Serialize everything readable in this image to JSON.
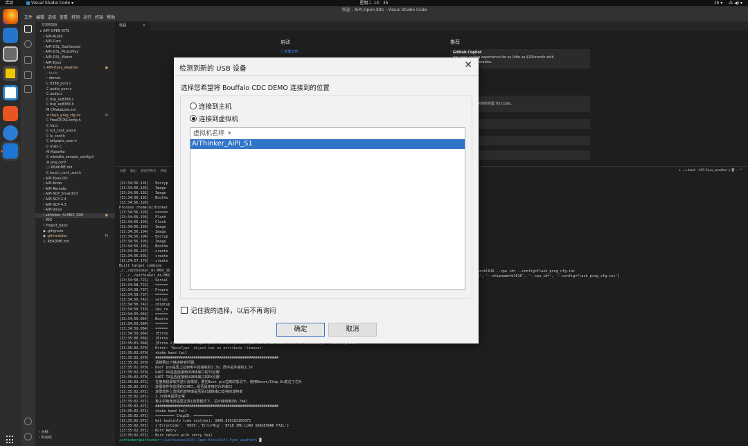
{
  "system_bar": {
    "activities": "活动",
    "app_name": "Visual Studio Code ▾",
    "clock": "星期二 13：35",
    "tray": [
      "zh ▾",
      "⁂ ◀) ▾"
    ]
  },
  "window": {
    "title": "欢迎 - AiPi-Open-Kits - Visual Studio Code",
    "menu": [
      "文件",
      "编辑",
      "选择",
      "查看",
      "转到",
      "运行",
      "终端",
      "帮助"
    ]
  },
  "explorer": {
    "header": "资源管理器",
    "items": [
      {
        "label": "∨ AIPI-OPEN-KITS",
        "indent": 0
      },
      {
        "label": "› AiPi-Audio",
        "indent": 1
      },
      {
        "label": "› AiPi-Cam",
        "indent": 1
      },
      {
        "label": "› AiPi-DSL_Dashboard",
        "indent": 1
      },
      {
        "label": "› AiPi-DSL_MusicPlay",
        "indent": 1
      },
      {
        "label": "› AiPi-DSL_Watch",
        "indent": 1
      },
      {
        "label": "› AiPi-Eyes",
        "indent": 1
      },
      {
        "label": "∨ AiPi-Eyes_weather",
        "indent": 1,
        "badge": "●",
        "color": "#e2c08d"
      },
      {
        "label": "› build",
        "indent": 2,
        "color": "#8c8c8c"
      },
      {
        "label": "› demos",
        "indent": 2
      },
      {
        "label": "C  8388_pcm.c",
        "indent": 2
      },
      {
        "label": "C  audio_pcm.c",
        "indent": 2
      },
      {
        "label": "C  audio.c",
        "indent": 2
      },
      {
        "label": "C  bsp_es8388.c",
        "indent": 2
      },
      {
        "label": "C  bsp_es8388.h",
        "indent": 2
      },
      {
        "label": "M  CMakeLists.txt",
        "indent": 2
      },
      {
        "label": "≡  flash_prog_cfg.ini",
        "indent": 2,
        "badge": "M",
        "color": "#e2c08d"
      },
      {
        "label": "C  FreeRTOSConfig.h",
        "indent": 2
      },
      {
        "label": "C  hal.c",
        "indent": 2
      },
      {
        "label": "C  lcd_conf_user.h",
        "indent": 2
      },
      {
        "label": "C  lv_conf.h",
        "indent": 2
      },
      {
        "label": "C  lwipopts_user.h",
        "indent": 2
      },
      {
        "label": "C  main.c",
        "indent": 2
      },
      {
        "label": "M  Makefile",
        "indent": 2
      },
      {
        "label": "C  mbedtls_sample_config.h",
        "indent": 2
      },
      {
        "label": "⚙  proj.conf",
        "indent": 2
      },
      {
        "label": "ⓘ  README.md",
        "indent": 2
      },
      {
        "label": "C  touch_conf_user.h",
        "indent": 2
      },
      {
        "label": "› AiPi-Eyes-DU",
        "indent": 1
      },
      {
        "label": "› AiPi-Knob",
        "indent": 1
      },
      {
        "label": "› AiPi-Remote",
        "indent": 1
      },
      {
        "label": "› AiPi-SCP_SmartCtrl",
        "indent": 1
      },
      {
        "label": "› AiPi-SCP-2.4",
        "indent": 1
      },
      {
        "label": "› AiPi-SCP-4.3",
        "indent": 1
      },
      {
        "label": "› AiPi-Voice",
        "indent": 1
      },
      {
        "label": "› aithinker_Ai-M6X_SDK",
        "indent": 1,
        "badge": "●",
        "selected": true
      },
      {
        "label": "› IMG",
        "indent": 1
      },
      {
        "label": "› Project_basic",
        "indent": 1
      },
      {
        "label": "◆ .gitignore",
        "indent": 1
      },
      {
        "label": "◆ .gitmodules",
        "indent": 1,
        "badge": "M",
        "color": "#e2c08d"
      },
      {
        "label": "ⓘ README.md",
        "indent": 1
      }
    ],
    "footer": [
      "› 大纲",
      "› 时间线"
    ]
  },
  "editor": {
    "tab": "欢迎",
    "start": {
      "heading": "启动",
      "link": "新建文件..."
    },
    "recommend": {
      "heading": "推荐",
      "cards": [
        {
          "title": "GitHub Copilot",
          "desc": "rge your coding experience for as little as $10/month with",
          "desc2": "ge AI code generation."
        },
        {
          "title": "VS Code",
          "desc": "自定义方法，使用你的专属 VS Code。"
        },
        {
          "title": "入门",
          "tag": "新建"
        },
        {
          "title": "自识"
        },
        {
          "title": "效率"
        }
      ]
    }
  },
  "panel": {
    "tabs": [
      "问题",
      "输出",
      "调试控制台",
      "终端"
    ],
    "right": "+ ⌄  ▸ bash - AiPi-Eyes_weather  ▯  🗑  ···  ⌃",
    "terminal_lines": [
      "[13:34:56.191] - Encryp",
      "[13:34:56.192] - Image",
      "[13:34:56.192] - Image",
      "[13:34:56.192] - Boothe",
      "[13:34:56.193]",
      "Process /home/aithinker",
      "[13:34:56.193] - ======",
      "[13:34:56.193] - Flash",
      "[13:34:56.193] - Clock",
      "[13:34:56.193] - Image",
      "[13:34:56.194] - Image",
      "[13:34:56.194] - Encryp",
      "[13:34:56.195] - Image",
      "[13:34:56.195] - Boothe",
      "[13:34:56.197] - create",
      "[13:34:56.501] - create",
      "[13:34:57.176] - create",
      "Built target combine",
      "./../aithinker_Ai-M6X_SD",
      "['../../aithinker_Ai-M6X",
      "[13:34:58.721] - Serial",
      "[13:34:58.722] - ======",
      "[13:34:58.737] - Progra",
      "[13:34:58.737] - ======",
      "[13:34:58.742] - serial",
      "[13:34:58.742] - chiptyp",
      "[13:34:58.743] - cpu_re",
      "[13:34:59.064] - ======",
      "[13:34:59.064] - Bootro",
      "[13:34:59.064] - ======",
      "[13:34:59.064] - ======",
      "[13:34:59.064] - [Errno",
      "[13:35:00.066] - [Errno",
      "[13:35:01.068] - [Errno 2] Could not open port /dev/ttyACM0: [Errno 2] No such file or directory: '/dev/ttyACM0'",
      "[13:35:02.070] - Error: 'NoneType' object has no attribute 'timeout'",
      "[13:35:02.070] - shake hand fail",
      "[13:35:02.070] - ##########################################################",
      "[13:35:02.070] - 请按照以下描述排查问题：",
      "[13:35:02.070] - Boot pin是否上拉到电平且接地的3.3V，而不是外接的3.3V",
      "[13:35:02.070] - UART RX是否连接到USB转串口的TX引脚",
      "[13:35:02.070] - UART TX是否连接到USB转串口的RX引脚",
      "[13:35:02.071] - 在使用烧录软件进行烧录前，要在Boot pin拉高的情况下，使用Reset/Chip_En复位了芯片",
      "[13:35:02.071] - 烧录软件所选择的COM口，是否是连接芯片的串口",
      "[13:35:02.071] - 烧录软件上选择的波特率是否是USB转串口支持的波特率",
      "[13:35:02.071] - 3.3V供电是否正常",
      "[13:35:02.071] - 板子供电电流是否正常(烧录模式下，芯片耗电电流5-7mA)",
      "[13:35:02.071] - ##########################################################",
      "[13:35:02.071] - shake hand fail",
      "[13:35:02.071] - ========= ChipID: =========",
      "[13:35:02.071] - Get bootinfo time cost(ms): 3006.816162109375",
      "[13:35:02.071] - {'ErrorCode': '0050','ErrorMsg':'BFLB IMG LOAD SHAKEHAND FAIL'}",
      "[13:35:02.071] - Burn Retry",
      "[13:35:02.071] - Burn return with retry fail"
    ],
    "prompt_user": "aithinker@aithinker",
    "prompt_path": ":~/workspace/AiPi-Open-Kits/AiPi-Eyes_weather$ ",
    "right_text1": "name=bl616 --cpu_id= --config=flash_prog_cfg.ini",
    "right_text2": "CM0', '--chipname=bl616', '--cpu_id=', '--config=flash_prog_cfg.ini']"
  },
  "dialog": {
    "title": "检测到新的 USB 设备",
    "close": "✕",
    "prompt": "选择您希望将 Bouffalo CDC DEMO 连接到的位置",
    "option_host": "连接到主机",
    "option_vm": "连接到虚拟机",
    "list_header": "虚拟机名称",
    "list_header_arrow": "▾",
    "vm_selected": "AiThinker_AiPi_S1",
    "remember": "记住我的选择，以后不再询问",
    "ok": "确定",
    "cancel": "取消",
    "selected_option": "vm"
  }
}
